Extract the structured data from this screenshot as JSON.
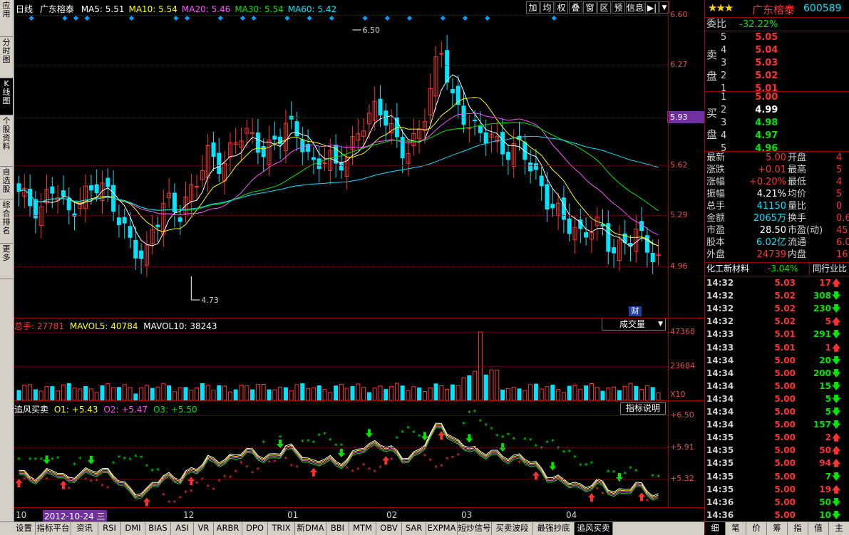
{
  "left_tabs": [
    "应用",
    "分时图",
    "K线图",
    "个股资料",
    "自选股",
    "综合排名",
    "更多"
  ],
  "chart": {
    "period_label": "日线",
    "stock_name": "广东榕泰",
    "ma": [
      {
        "label": "MA5: 5.51",
        "color": "#ffffff"
      },
      {
        "label": "MA10: 5.54",
        "color": "#ffff00"
      },
      {
        "label": "MA20: 5.46",
        "color": "#ff50ff"
      },
      {
        "label": "MA30: 5.54",
        "color": "#00e600"
      },
      {
        "label": "MA60: 5.42",
        "color": "#00e5ff"
      }
    ],
    "toolbar": [
      "加",
      "均",
      "权",
      "叠",
      "窗",
      "区",
      "预",
      "信息",
      "▶|"
    ],
    "price_axis": [
      "6.60",
      "6.27",
      "5.93",
      "5.62",
      "5.29",
      "4.96"
    ],
    "current_price_marker": "5.93",
    "high_annotation": "6.50",
    "low_annotation": "4.73",
    "fin_badge": "财",
    "volume_header": {
      "total": "总手: 27781",
      "mavol5": "MAVOL5: 40784",
      "mavol10": "MAVOL10: 38243"
    },
    "volume_selector": "成交量",
    "volume_axis": [
      "47368",
      "23684",
      "X10"
    ],
    "indicator_header": {
      "name": "追风买卖",
      "o1": "O1: +5.43",
      "o2": "O2: +5.47",
      "o3": "O3: +5.50"
    },
    "indicator_button": "指标说明",
    "indicator_axis": [
      "+6.50",
      "+5.91",
      "+5.32"
    ],
    "x_labels": [
      "10",
      "2012-10-24 三",
      "12",
      "01",
      "02",
      "03",
      "04"
    ]
  },
  "right_panel": {
    "stock_name": "广东榕泰",
    "stock_code": "600589",
    "weibi_label": "委比",
    "weibi_value": "-32.22%",
    "sell_label": [
      "卖",
      "盘"
    ],
    "buy_label": [
      "买",
      "盘"
    ],
    "asks": [
      {
        "level": "5",
        "price": "5.05"
      },
      {
        "level": "4",
        "price": "5.04"
      },
      {
        "level": "3",
        "price": "5.03"
      },
      {
        "level": "2",
        "price": "5.02"
      },
      {
        "level": "1",
        "price": "5.01"
      }
    ],
    "bids": [
      {
        "level": "1",
        "price": "5.00"
      },
      {
        "level": "2",
        "price": "4.99"
      },
      {
        "level": "3",
        "price": "4.98"
      },
      {
        "level": "4",
        "price": "4.97"
      },
      {
        "level": "5",
        "price": "4.96"
      }
    ],
    "stats": [
      {
        "l1": "最新",
        "v1": "5.00",
        "c1": "red",
        "l2": "开盘",
        "v2": "4"
      },
      {
        "l1": "涨跌",
        "v1": "+0.01",
        "c1": "red",
        "l2": "最高",
        "v2": "5"
      },
      {
        "l1": "涨幅",
        "v1": "+0.20%",
        "c1": "red",
        "l2": "最低",
        "v2": "4"
      },
      {
        "l1": "振幅",
        "v1": "4.21%",
        "c1": "white",
        "l2": "均价",
        "v2": "5"
      },
      {
        "l1": "总手",
        "v1": "41150",
        "c1": "cyan",
        "l2": "量比",
        "v2": "0"
      },
      {
        "l1": "金额",
        "v1": "2065万",
        "c1": "cyan",
        "l2": "换手",
        "v2": "0.6"
      },
      {
        "l1": "市盈",
        "v1": "28.50",
        "c1": "white",
        "l2": "市盈(动)",
        "v2": "45"
      },
      {
        "l1": "股本",
        "v1": "6.02亿",
        "c1": "cyan",
        "l2": "流通",
        "v2": "6.0"
      },
      {
        "l1": "外盘",
        "v1": "24739",
        "c1": "red",
        "l2": "内盘",
        "v2": "16"
      }
    ],
    "industry": {
      "name": "化工新材料",
      "change": "-3.04%",
      "compare": "同行业比"
    },
    "ticks": [
      {
        "t": "14:32",
        "p": "5.03",
        "v": "17",
        "dir": "up"
      },
      {
        "t": "14:32",
        "p": "5.02",
        "v": "308",
        "dir": "down"
      },
      {
        "t": "14:32",
        "p": "5.02",
        "v": "230",
        "dir": "down"
      },
      {
        "t": "14:32",
        "p": "5.02",
        "v": "5",
        "dir": "up"
      },
      {
        "t": "14:33",
        "p": "5.01",
        "v": "291",
        "dir": "down"
      },
      {
        "t": "14:33",
        "p": "5.01",
        "v": "1",
        "dir": "up"
      },
      {
        "t": "14:34",
        "p": "5.00",
        "v": "20",
        "dir": "down"
      },
      {
        "t": "14:34",
        "p": "5.00",
        "v": "200",
        "dir": "down"
      },
      {
        "t": "14:34",
        "p": "5.00",
        "v": "15",
        "dir": "down"
      },
      {
        "t": "14:34",
        "p": "5.00",
        "v": "5",
        "dir": "down"
      },
      {
        "t": "14:34",
        "p": "5.00",
        "v": "5",
        "dir": "down"
      },
      {
        "t": "14:34",
        "p": "5.00",
        "v": "157",
        "dir": "down"
      },
      {
        "t": "14:35",
        "p": "5.00",
        "v": "2",
        "dir": "up"
      },
      {
        "t": "14:35",
        "p": "5.00",
        "v": "50",
        "dir": "up"
      },
      {
        "t": "14:35",
        "p": "5.00",
        "v": "94",
        "dir": "up"
      },
      {
        "t": "14:35",
        "p": "5.00",
        "v": "7",
        "dir": "down"
      },
      {
        "t": "14:35",
        "p": "5.00",
        "v": "19",
        "dir": "up"
      },
      {
        "t": "14:36",
        "p": "5.00",
        "v": "50",
        "dir": "down"
      },
      {
        "t": "14:36",
        "p": "5.00",
        "v": "10",
        "dir": "down"
      }
    ],
    "bottom_tabs": [
      "细",
      "笔",
      "价",
      "筹",
      "指",
      "值",
      "主"
    ]
  },
  "bottom_tabs": [
    "设置",
    "指标平台",
    "资讯",
    "RSI",
    "DMI",
    "BIAS",
    "ASI",
    "VR",
    "ARBR",
    "DPO",
    "TRIX",
    "新DMA",
    "BBI",
    "MTM",
    "OBV",
    "SAR",
    "EXPMA",
    "短炒信号",
    "买卖波段",
    "最强抄底",
    "追风买卖"
  ],
  "active_bottom_tab": "追风买卖",
  "colors": {
    "up": "#ff3232",
    "down": "#00e5ff",
    "background": "#000000",
    "grid": "#800000"
  }
}
